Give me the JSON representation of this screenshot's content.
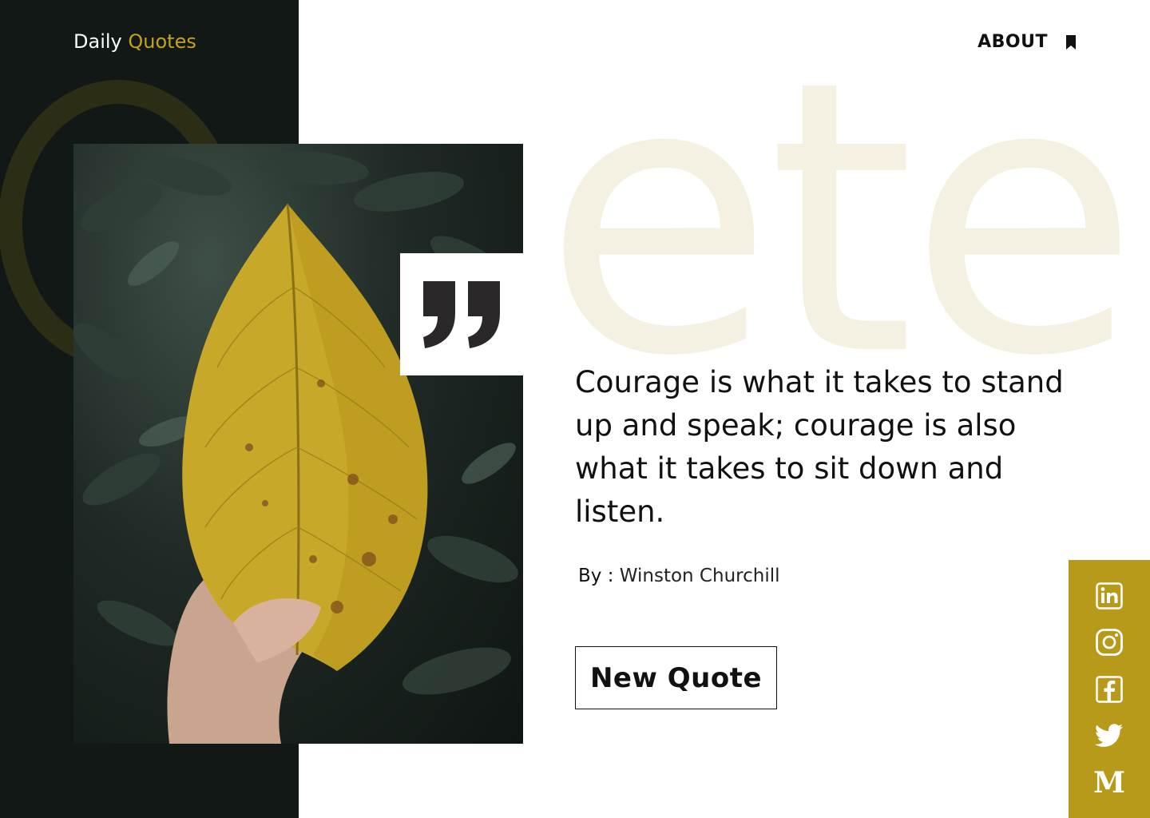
{
  "brand": {
    "prefix": "Daily",
    "accent": "Quotes"
  },
  "nav": {
    "about_label": "ABOUT",
    "bookmark_icon": "bookmark-icon"
  },
  "background": {
    "letters": "ete"
  },
  "quote": {
    "text": "Courage is what it takes to stand up and speak; courage is also what it takes to sit down and listen.",
    "author_prefix": "By :",
    "author_name": "Winston Churchill"
  },
  "actions": {
    "new_quote_label": "New Quote"
  },
  "social": {
    "icons": [
      "linkedin-icon",
      "instagram-icon",
      "facebook-icon",
      "twitter-icon",
      "medium-icon"
    ],
    "medium_glyph": "M"
  },
  "colors": {
    "accent": "#c6a21c",
    "panel": "#111816",
    "social_bg": "#b89a1a",
    "ghost_letters": "#f5f1e2"
  }
}
